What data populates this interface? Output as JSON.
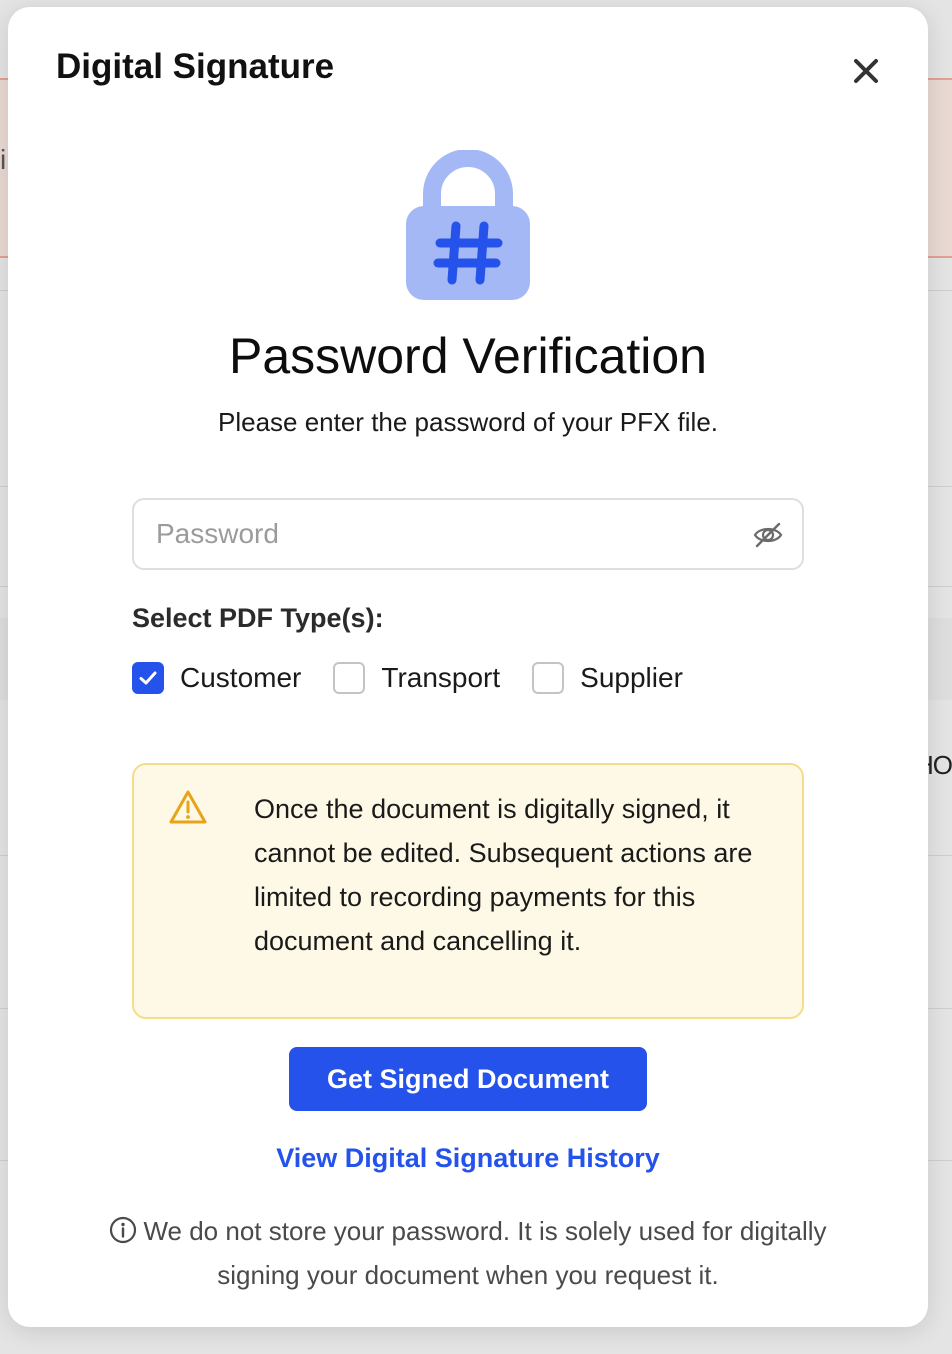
{
  "modal": {
    "title": "Digital Signature",
    "close_icon": "close-icon",
    "hero_icon": "lock-hash-icon",
    "heading": "Password Verification",
    "subheading": "Please enter the password of your PFX file."
  },
  "password": {
    "placeholder": "Password",
    "value": "",
    "visibility_icon": "eye-off-icon"
  },
  "pdf_types": {
    "label": "Select PDF Type(s):",
    "options": [
      {
        "label": "Customer",
        "checked": true
      },
      {
        "label": "Transport",
        "checked": false
      },
      {
        "label": "Supplier",
        "checked": false
      }
    ]
  },
  "warning": {
    "icon": "warning-triangle-icon",
    "text": "Once the document is digitally signed, it cannot be edited. Subsequent actions are limited to recording payments for this document and cancelling it."
  },
  "actions": {
    "primary_label": "Get Signed Document",
    "history_link": "View Digital Signature History"
  },
  "footnote": {
    "icon": "info-icon",
    "text": "We do not store your password. It is solely used for digitally signing your document when you request it."
  },
  "background_fragments": {
    "left": "i",
    "right": "HO"
  },
  "colors": {
    "accent": "#2452ea",
    "lock_body": "#a3b8f5",
    "warning_bg": "#fef9e6",
    "warning_border": "#f5dc8a",
    "warning_icon": "#e8a317"
  }
}
